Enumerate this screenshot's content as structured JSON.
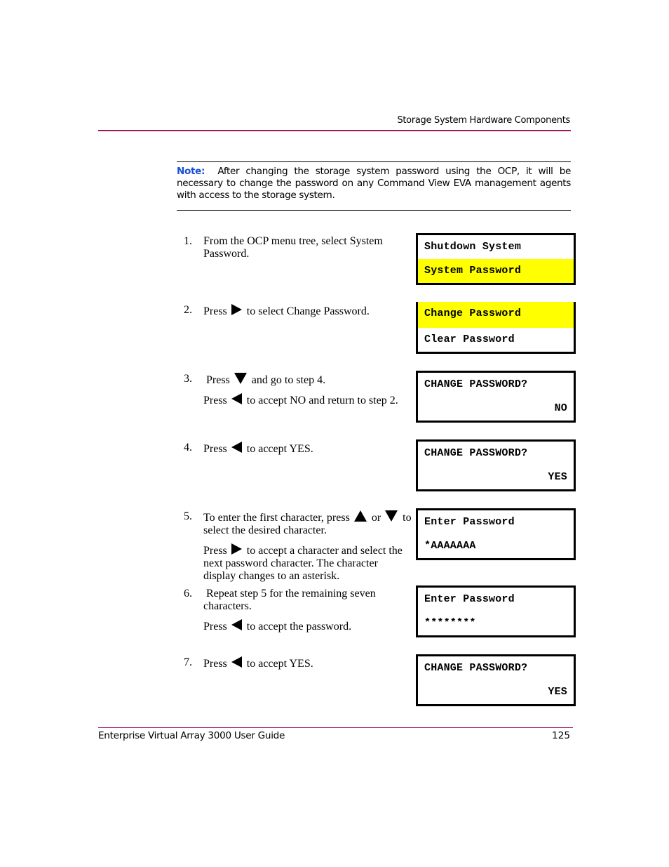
{
  "header": {
    "title": "Storage System Hardware Components"
  },
  "note": {
    "label": "Note:",
    "text": "After changing the storage system password using the OCP, it will be necessary to change the password on any Command View EVA management agents with access to the storage system."
  },
  "icons": {
    "right": "right-arrow-button-icon",
    "left": "left-arrow-button-icon",
    "up": "up-arrow-button-icon",
    "down": "down-arrow-button-icon"
  },
  "steps": [
    {
      "num": "1.",
      "p1": "From the OCP menu tree, select System Password."
    },
    {
      "num": "2.",
      "pre": "Press",
      "post": "to select Change Password."
    },
    {
      "num": "3.",
      "a_pre": "Press",
      "a_post": "and go to step 4.",
      "b_pre": "Press",
      "b_post": "to accept NO and return to step 2."
    },
    {
      "num": "4.",
      "pre": "Press",
      "post": "to accept YES."
    },
    {
      "num": "5.",
      "a_pre": "To enter the first character, press",
      "a_mid": "or",
      "a_post": "to select the desired character.",
      "b_pre": "Press",
      "b_post": "to accept a character and select the next password character. The character display changes to an asterisk."
    },
    {
      "num": "6.",
      "a": "Repeat step 5 for the remaining seven characters.",
      "b_pre": "Press",
      "b_post": "to accept the password."
    },
    {
      "num": "7.",
      "pre": "Press",
      "post": "to accept YES."
    }
  ],
  "displays": [
    {
      "line1": "Shutdown System",
      "line2": "System Password",
      "highlighted": 2
    },
    {
      "line1": "Change Password",
      "line2": "Clear Password",
      "highlighted": 1
    },
    {
      "line1": "CHANGE PASSWORD?",
      "line2": "NO"
    },
    {
      "line1": "CHANGE PASSWORD?",
      "line2": "YES"
    },
    {
      "line1": "Enter Password",
      "line2": "*AAAAAAA"
    },
    {
      "line1": "Enter Password",
      "line2": "********"
    },
    {
      "line1": "CHANGE PASSWORD?",
      "line2": "YES"
    }
  ],
  "colors": {
    "accent_rule": "#a0185a",
    "note_label": "#1a4fd6",
    "highlight": "#ffff00"
  },
  "footer": {
    "title": "Enterprise Virtual Array 3000 User Guide",
    "page": "125"
  }
}
